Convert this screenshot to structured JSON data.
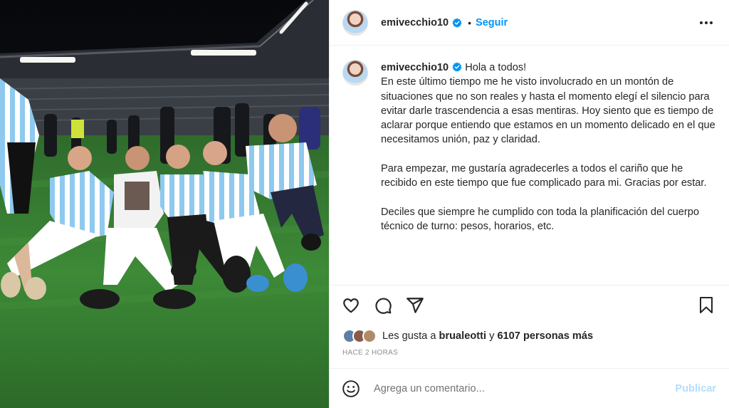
{
  "post": {
    "username": "emivecchio10",
    "follow_label": "Seguir",
    "separator": "•",
    "more_options_icon": "more-options-icon",
    "verified_icon": "verified-badge-icon"
  },
  "caption": {
    "username": "emivecchio10",
    "greeting": "Hola a todos!",
    "paragraphs": [
      "En este último tiempo me he visto involucrado en un montón de situaciones que no son reales y hasta el momento elegí el silencio para evitar darle trascendencia a esas mentiras. Hoy siento que es tiempo de aclarar porque entiendo que estamos en un momento delicado en el que necesitamos unión, paz y claridad.",
      "Para empezar, me gustaría agradecerles a todos el cariño que he recibido en este tiempo que fue complicado para mi. Gracias por estar.",
      "Deciles que siempre he cumplido con toda la planificación del cuerpo técnico de turno: pesos, horarios, etc."
    ]
  },
  "actions": {
    "like_icon": "heart-icon",
    "comment_icon": "comment-icon",
    "share_icon": "share-icon",
    "save_icon": "bookmark-icon"
  },
  "likes": {
    "prefix": "Les gusta a ",
    "user": "brualeotti",
    "middle": " y ",
    "count_text": "6107 personas más"
  },
  "timestamp": "HACE 2 HORAS",
  "comment_box": {
    "placeholder": "Agrega un comentario...",
    "publish_label": "Publicar",
    "emoji_icon": "emoji-icon"
  },
  "colors": {
    "accent": "#0095f6",
    "publish_disabled": "#b2dffc",
    "text": "#262626",
    "muted": "#8e8e8e",
    "border": "#efefef"
  }
}
